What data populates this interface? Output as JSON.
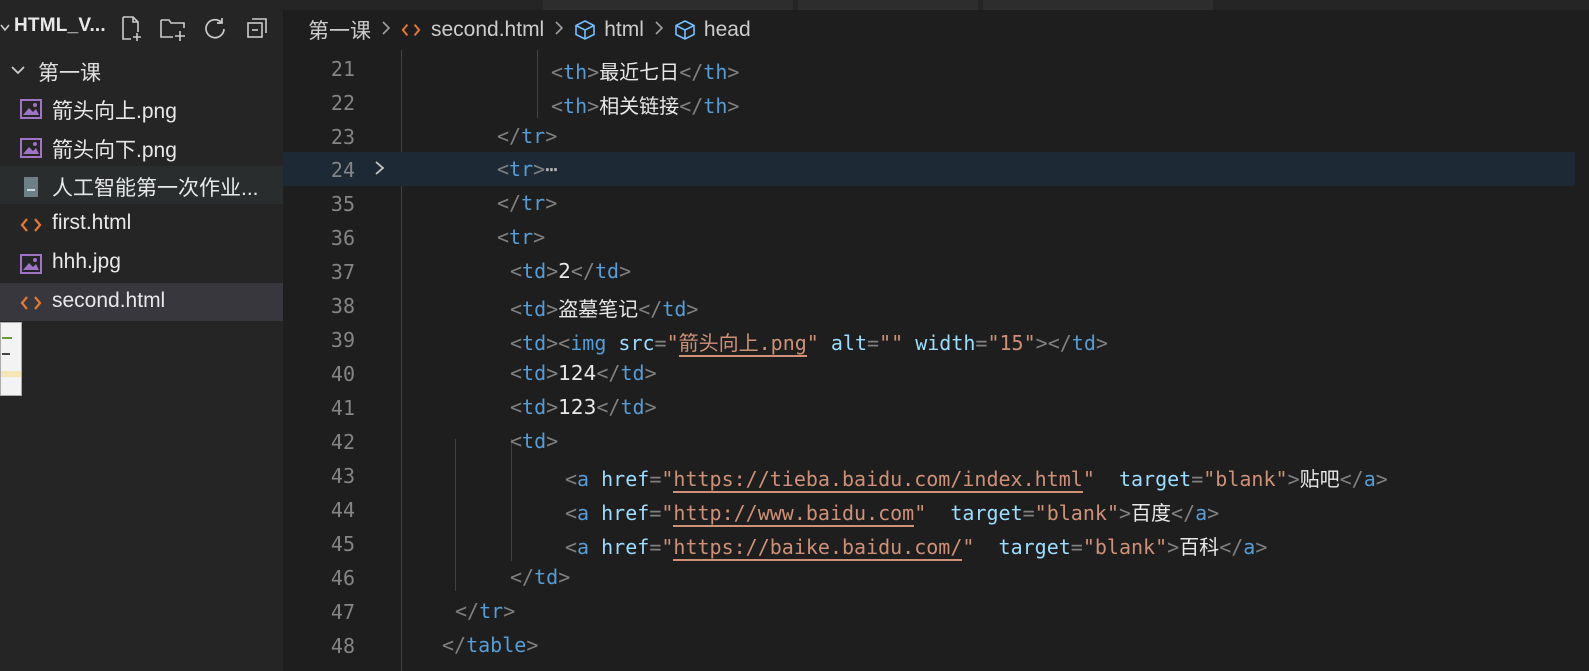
{
  "explorer": {
    "workspace_title": "HTML_V...",
    "folder_name": "第一课",
    "files": [
      {
        "name": "箭头向上.png",
        "type": "image"
      },
      {
        "name": "箭头向下.png",
        "type": "image"
      },
      {
        "name": "人工智能第一次作业...",
        "type": "document"
      },
      {
        "name": "first.html",
        "type": "html"
      },
      {
        "name": "hhh.jpg",
        "type": "image"
      },
      {
        "name": "second.html",
        "type": "html"
      }
    ],
    "active_file": "second.html"
  },
  "breadcrumb": {
    "folder": "第一课",
    "file": "second.html",
    "node1": "html",
    "node2": "head"
  },
  "code": {
    "lines": [
      {
        "no": "21"
      },
      {
        "no": "22"
      },
      {
        "no": "23"
      },
      {
        "no": "24"
      },
      {
        "no": "35"
      },
      {
        "no": "36"
      },
      {
        "no": "37"
      },
      {
        "no": "38"
      },
      {
        "no": "39"
      },
      {
        "no": "40"
      },
      {
        "no": "41"
      },
      {
        "no": "42"
      },
      {
        "no": "43"
      },
      {
        "no": "44"
      },
      {
        "no": "45"
      },
      {
        "no": "46"
      },
      {
        "no": "47"
      },
      {
        "no": "48"
      }
    ],
    "text": {
      "th1": "最近七日",
      "th2": "相关链接",
      "td_num": "2",
      "td_name": "盗墓笔记",
      "img_src": "箭头向上.png",
      "img_alt": "",
      "img_width": "15",
      "td_a": "124",
      "td_b": "123",
      "link1_href": "https://tieba.baidu.com/index.html",
      "link1_text": "贴吧",
      "link2_href": "http://www.baidu.com",
      "link2_text": "百度",
      "link3_href": "https://baike.baidu.com/",
      "link3_text": "百科",
      "target_value": "blank",
      "fold_ellipsis": "⋯"
    }
  },
  "colors": {
    "tag": "#569cd6",
    "attr": "#9cdcfe",
    "string": "#ce9178",
    "punct": "#808080",
    "html_icon": "#e37933",
    "image_icon": "#a074c4"
  }
}
